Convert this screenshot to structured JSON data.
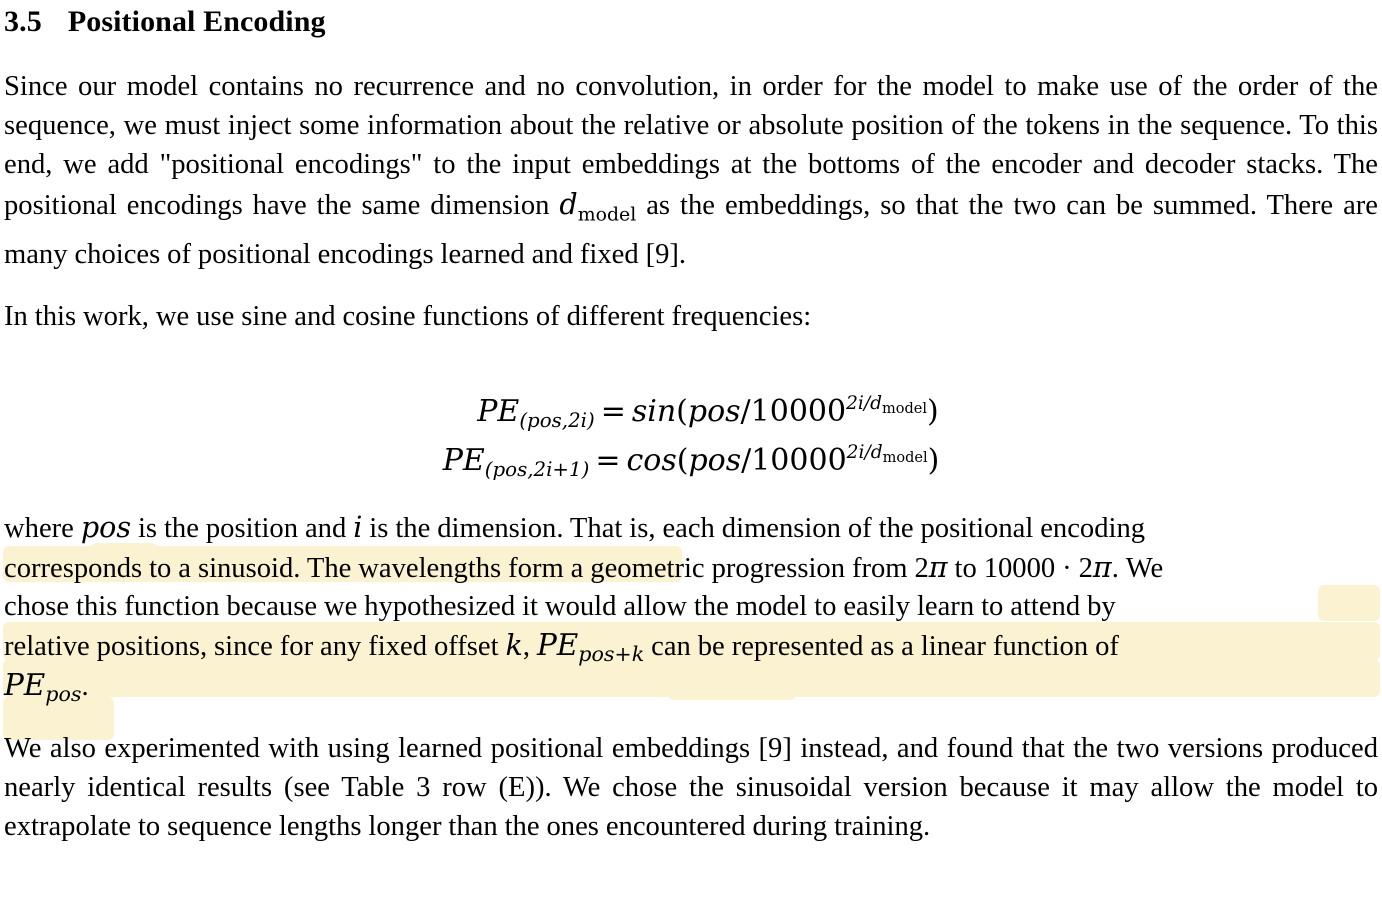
{
  "document": {
    "type": "academic-paper-page",
    "background_color": "#ffffff",
    "text_color": "#000000",
    "highlight_color": "#fbf2d2"
  },
  "heading": {
    "number": "3.5",
    "title": "Positional Encoding"
  },
  "paragraphs": {
    "intro": "Since our model contains no recurrence and no convolution, in order for the model to make use of the order of the sequence, we must inject some information about the relative or absolute position of the tokens in the sequence. To this end, we add \"positional encodings\" to the input embeddings at the bottoms of the encoder and decoder stacks. The positional encodings have the same dimension d_model as the embeddings, so that the two can be summed. There are many choices of positional encodings learned and fixed [9].",
    "intro_segments": {
      "a": "Since our model contains no recurrence and no convolution, in order for the model to make use of the order of the sequence, we must inject some information about the relative or absolute position of the tokens in the sequence. To this end, we add \"positional encodings\" to the input embeddings at the bottoms of the encoder and decoder stacks. The positional encodings have the same dimension ",
      "dmodel_base": "d",
      "dmodel_sub": "model",
      "b": " as the embeddings, so that the two can be summed. There are many choices of positional encodings learned and fixed [9]."
    },
    "in_this_work": "In this work, we use sine and cosine functions of different frequencies:",
    "learned": "We also experimented with using learned positional embeddings [9] instead, and found that the two versions produced nearly identical results (see Table 3 row (E)). We chose the sinusoidal version because it may allow the model to extrapolate to sequence lengths longer than the ones encountered during training."
  },
  "equations": [
    {
      "id": "pe-sin",
      "lhs_base": "PE",
      "lhs_sub": "(pos,2i)",
      "relation": "=",
      "rhs_fn": "sin",
      "rhs_arg_num": "pos",
      "rhs_slash": "/",
      "rhs_base": "10000",
      "rhs_exp_num": "2i",
      "rhs_exp_slash": "/",
      "rhs_exp_den_base": "d",
      "rhs_exp_den_sub": "model",
      "plain": "PE_(pos,2i) = sin(pos/10000^(2i/d_model))"
    },
    {
      "id": "pe-cos",
      "lhs_base": "PE",
      "lhs_sub": "(pos,2i+1)",
      "relation": "=",
      "rhs_fn": "cos",
      "rhs_arg_num": "pos",
      "rhs_slash": "/",
      "rhs_base": "10000",
      "rhs_exp_num": "2i",
      "rhs_exp_slash": "/",
      "rhs_exp_den_base": "d",
      "rhs_exp_den_sub": "model",
      "plain": "PE_(pos,2i+1) = cos(pos/10000^(2i/d_model))"
    }
  ],
  "where_paragraph": {
    "plain": "where pos is the position and i is the dimension. That is, each dimension of the positional encoding corresponds to a sinusoid. The wavelengths form a geometric progression from 2π to 10000 · 2π. We chose this function because we hypothesized it would allow the model to easily learn to attend by relative positions, since for any fixed offset k, PE_{pos+k} can be represented as a linear function of PE_{pos}.",
    "lines": [
      {
        "id": "line1",
        "segments": [
          {
            "text": "where ",
            "style": "roman",
            "highlight": true
          },
          {
            "text": "pos",
            "style": "math-italic",
            "highlight": true
          },
          {
            "text": " is the position and ",
            "style": "roman",
            "highlight": true
          },
          {
            "text": "i",
            "style": "math-italic",
            "highlight": true
          },
          {
            "text": " is the dimension.",
            "style": "roman",
            "highlight": true
          },
          {
            "text": " That is, each dimension of the positional encoding",
            "style": "roman",
            "highlight": false
          }
        ]
      },
      {
        "id": "line2",
        "segments": [
          {
            "text": "corresponds to a sinusoid. The wavelengths form a geometric progression from 2",
            "style": "roman",
            "highlight": false
          },
          {
            "text": "π",
            "style": "math-italic",
            "highlight": false
          },
          {
            "text": " to 10000 · 2",
            "style": "roman",
            "highlight": false
          },
          {
            "text": "π",
            "style": "math-italic",
            "highlight": false
          },
          {
            "text": ".",
            "style": "roman",
            "highlight": false
          },
          {
            "text": " We",
            "style": "roman",
            "highlight": true
          }
        ]
      },
      {
        "id": "line3",
        "segments": [
          {
            "text": "chose this function because we hypothesized it would allow the model to easily learn to attend by",
            "style": "roman",
            "highlight": true
          }
        ]
      },
      {
        "id": "line4",
        "segments": [
          {
            "text": "relative positions, since for any fixed offset ",
            "style": "roman",
            "highlight": true
          },
          {
            "text": "k",
            "style": "math-italic",
            "highlight": true
          },
          {
            "text": ", ",
            "style": "roman",
            "highlight": true
          },
          {
            "text": "PE",
            "style": "math-italic",
            "highlight": true,
            "sub": "pos+k"
          },
          {
            "text": " can be represented as a linear function of",
            "style": "roman",
            "highlight": true
          }
        ]
      },
      {
        "id": "line5",
        "segments": [
          {
            "text": "PE",
            "style": "math-italic",
            "highlight": true,
            "sub": "pos"
          },
          {
            "text": ".",
            "style": "roman",
            "highlight": true
          }
        ]
      }
    ],
    "inline_math": {
      "pos": "pos",
      "i": "i",
      "k": "k",
      "two_pi": "2π",
      "ten_thousand_two_pi": "10000 · 2π",
      "pe_pos_plus_k_base": "PE",
      "pe_pos_plus_k_sub": "pos+k",
      "pe_pos_base": "PE",
      "pe_pos_sub": "pos"
    }
  }
}
